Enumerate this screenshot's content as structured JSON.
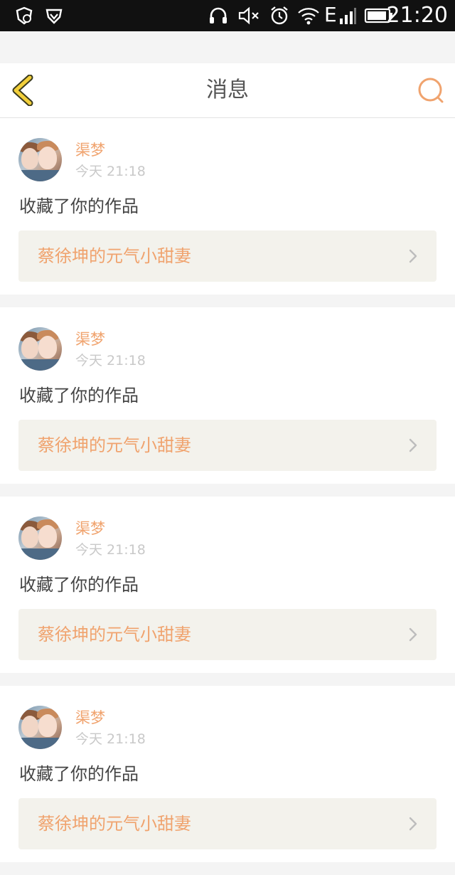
{
  "status_bar": {
    "time": "21:20",
    "network_label": "E",
    "icons": [
      "shield-badge-icon",
      "shield-check-icon",
      "headphones-icon",
      "volume-muted-icon",
      "alarm-icon",
      "wifi-icon",
      "signal-icon",
      "battery-icon"
    ]
  },
  "header": {
    "title": "消息",
    "back_icon": "chevron-left-icon",
    "search_icon": "search-icon"
  },
  "colors": {
    "accent": "#f0a36e",
    "back_arrow": "#f2cf3a",
    "card_link_bg": "#f3f2ec",
    "page_bg": "#f4f4f4"
  },
  "messages": [
    {
      "user": "渠梦",
      "time": "今天 21:18",
      "action": "收藏了你的作品",
      "work": "蔡徐坤的元气小甜妻"
    },
    {
      "user": "渠梦",
      "time": "今天 21:18",
      "action": "收藏了你的作品",
      "work": "蔡徐坤的元气小甜妻"
    },
    {
      "user": "渠梦",
      "time": "今天 21:18",
      "action": "收藏了你的作品",
      "work": "蔡徐坤的元气小甜妻"
    },
    {
      "user": "渠梦",
      "time": "今天 21:18",
      "action": "收藏了你的作品",
      "work": "蔡徐坤的元气小甜妻"
    }
  ]
}
